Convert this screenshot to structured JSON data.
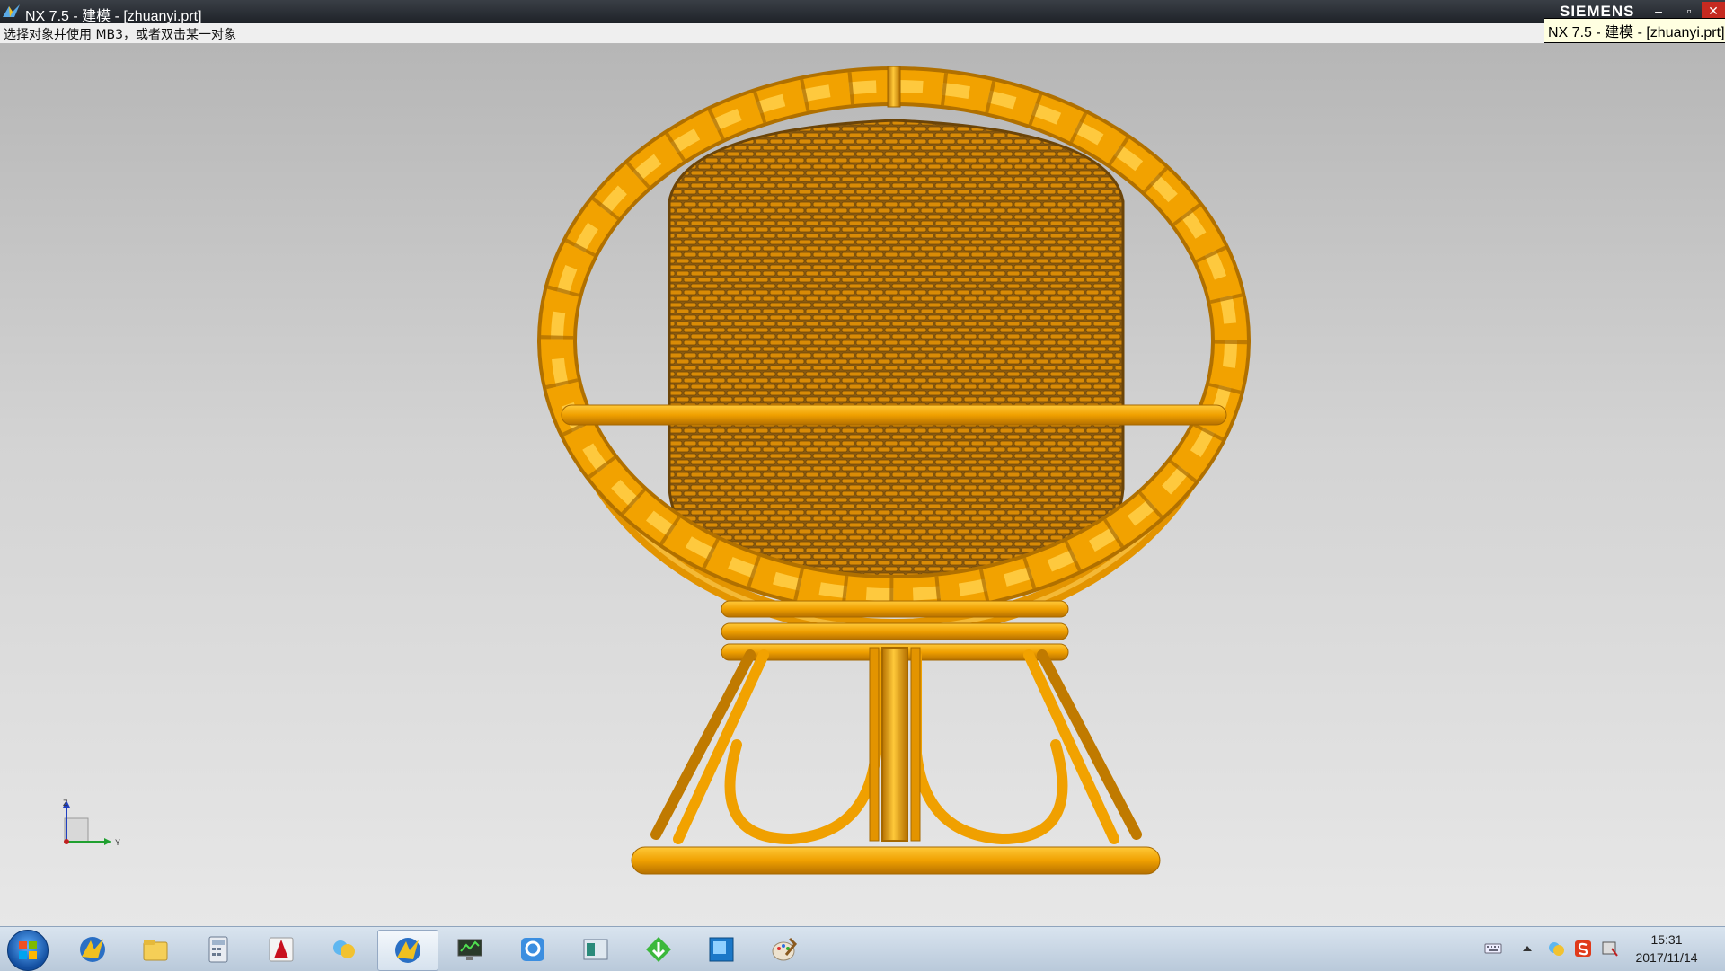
{
  "window": {
    "title": "NX 7.5 - 建模 - [zhuanyi.prt]",
    "brand": "SIEMENS",
    "controls": {
      "minimize": "–",
      "maximize": "▫",
      "close": "✕"
    }
  },
  "status": {
    "prompt": "选择对象并使用 MB3，或者双击某一对象"
  },
  "tooltip": {
    "text": "NX 7.5 - 建模 - [zhuanyi.prt]"
  },
  "viewport": {
    "model_color": "#f0a000",
    "background_top": "#b6b6b6",
    "background_bottom": "#e7e7e7",
    "triad_labels": {
      "z": "Z",
      "y": "Y"
    }
  },
  "taskbar": {
    "apps": [
      {
        "name": "nx-app-icon",
        "active": false
      },
      {
        "name": "file-explorer-icon",
        "active": false
      },
      {
        "name": "calculator-icon",
        "active": false
      },
      {
        "name": "autocad-icon",
        "active": false
      },
      {
        "name": "messenger-icon",
        "active": false
      },
      {
        "name": "nx-app-icon",
        "active": true
      },
      {
        "name": "monitor-icon",
        "active": false
      },
      {
        "name": "qq-icon",
        "active": false
      },
      {
        "name": "window-app-icon",
        "active": false
      },
      {
        "name": "download-icon",
        "active": false
      },
      {
        "name": "screen-app-icon",
        "active": false
      },
      {
        "name": "paint-icon",
        "active": false
      }
    ],
    "clock": {
      "time": "15:31",
      "date": "2017/11/14"
    }
  }
}
